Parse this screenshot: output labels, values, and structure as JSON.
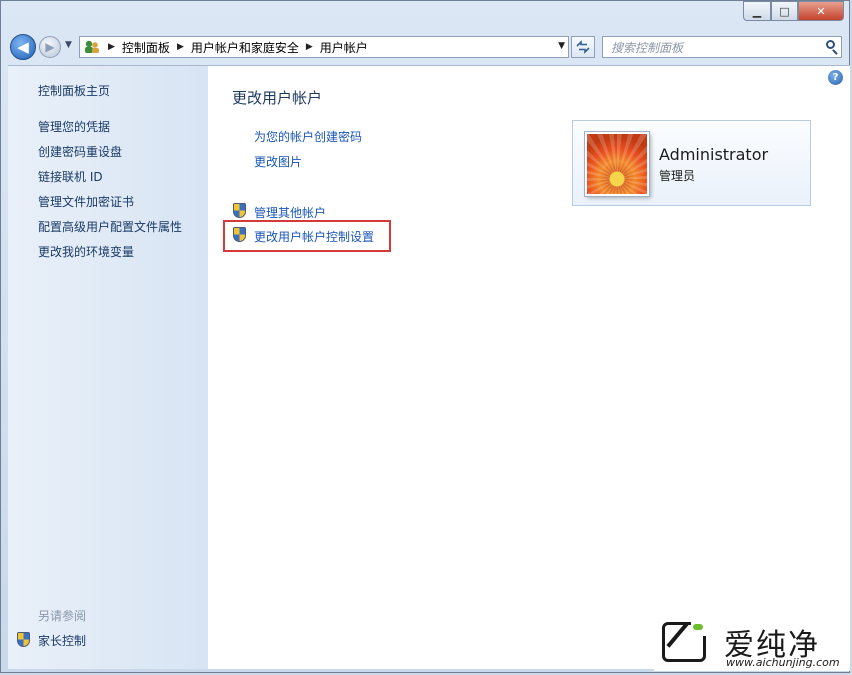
{
  "window": {
    "minimize": "▁",
    "maximize": "□",
    "close": "✕"
  },
  "nav": {
    "back_glyph": "◀",
    "forward_glyph": "▶",
    "breadcrumbs": [
      "控制面板",
      "用户帐户和家庭安全",
      "用户帐户"
    ],
    "search_placeholder": "搜索控制面板"
  },
  "sidebar": {
    "home": "控制面板主页",
    "items": [
      "管理您的凭据",
      "创建密码重设盘",
      "链接联机 ID",
      "管理文件加密证书",
      "配置高级用户配置文件属性",
      "更改我的环境变量"
    ],
    "see_also": "另请参阅",
    "parental": "家长控制"
  },
  "main": {
    "title": "更改用户帐户",
    "links": [
      "为您的帐户创建密码",
      "更改图片"
    ],
    "shield_links": [
      "管理其他帐户",
      "更改用户帐户控制设置"
    ]
  },
  "user": {
    "name": "Administrator",
    "role": "管理员"
  },
  "watermark": {
    "text": "爱纯净",
    "url": "www.aichunjing.com"
  }
}
